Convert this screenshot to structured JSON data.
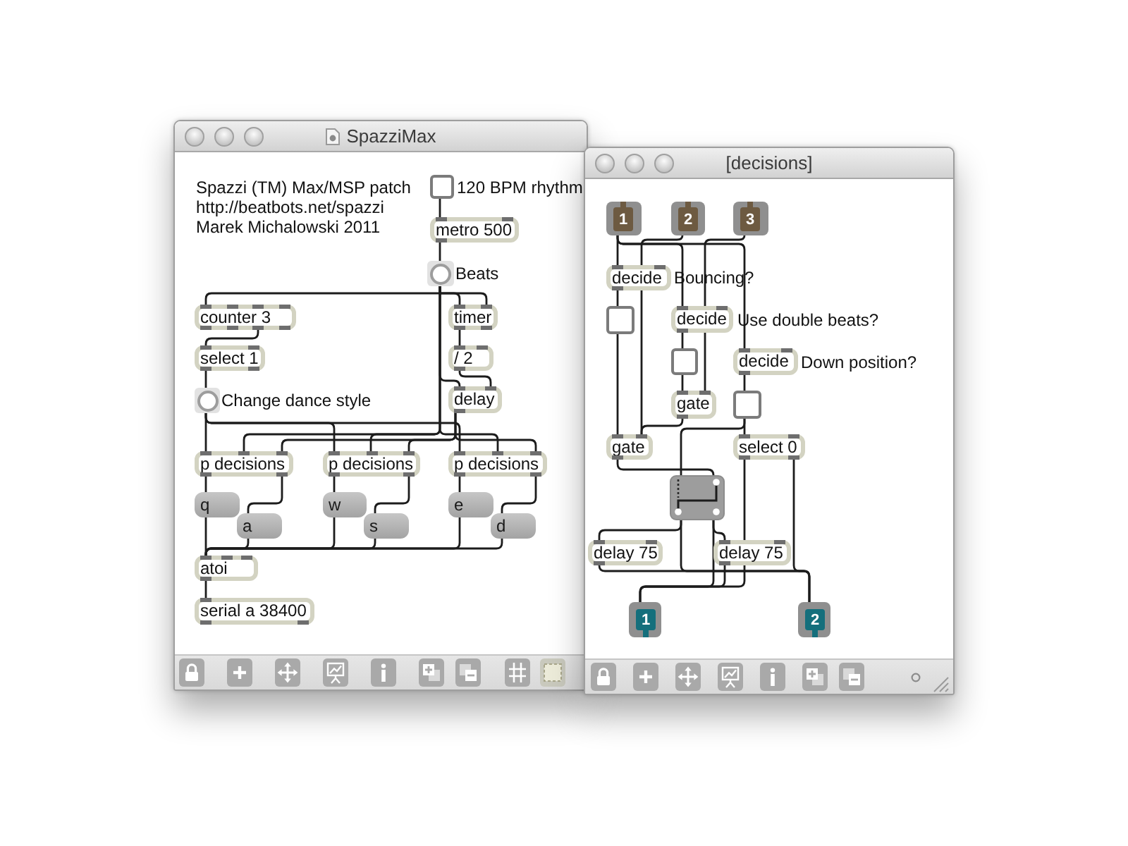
{
  "windows": [
    {
      "title": "SpazziMax",
      "boxes": [
        {
          "kind": "comment",
          "text": "Spazzi (TM) Max/MSP patch\nhttp://beatbots.net/spazzi\nMarek Michalowski 2011"
        },
        {
          "kind": "toggle",
          "checked": false
        },
        {
          "kind": "comment",
          "text": "120 BPM rhythm"
        },
        {
          "kind": "object",
          "text": "metro 500"
        },
        {
          "kind": "bang"
        },
        {
          "kind": "comment",
          "text": "Beats"
        },
        {
          "kind": "object",
          "text": "counter 3"
        },
        {
          "kind": "object",
          "text": "timer"
        },
        {
          "kind": "object",
          "text": "select 1"
        },
        {
          "kind": "object",
          "text": "/ 2"
        },
        {
          "kind": "bang"
        },
        {
          "kind": "comment",
          "text": "Change dance style"
        },
        {
          "kind": "object",
          "text": "delay"
        },
        {
          "kind": "object",
          "text": "p decisions"
        },
        {
          "kind": "object",
          "text": "p decisions"
        },
        {
          "kind": "object",
          "text": "p decisions"
        },
        {
          "kind": "message",
          "text": "q"
        },
        {
          "kind": "message",
          "text": "w"
        },
        {
          "kind": "message",
          "text": "e"
        },
        {
          "kind": "message",
          "text": "a"
        },
        {
          "kind": "message",
          "text": "s"
        },
        {
          "kind": "message",
          "text": "d"
        },
        {
          "kind": "object",
          "text": "atoi"
        },
        {
          "kind": "object",
          "text": "serial a 38400"
        }
      ]
    },
    {
      "title": "[decisions]",
      "boxes": [
        {
          "kind": "inlet",
          "text": "1"
        },
        {
          "kind": "inlet",
          "text": "2"
        },
        {
          "kind": "inlet",
          "text": "3"
        },
        {
          "kind": "object",
          "text": "decide"
        },
        {
          "kind": "comment",
          "text": "Bouncing?"
        },
        {
          "kind": "toggle",
          "checked": false
        },
        {
          "kind": "object",
          "text": "decide"
        },
        {
          "kind": "comment",
          "text": "Use double beats?"
        },
        {
          "kind": "toggle",
          "checked": false
        },
        {
          "kind": "object",
          "text": "decide"
        },
        {
          "kind": "comment",
          "text": "Down position?"
        },
        {
          "kind": "object",
          "text": "gate"
        },
        {
          "kind": "toggle",
          "checked": false
        },
        {
          "kind": "object",
          "text": "gate"
        },
        {
          "kind": "object",
          "text": "select 0"
        },
        {
          "kind": "gate_switch",
          "on": true
        },
        {
          "kind": "object",
          "text": "delay 75"
        },
        {
          "kind": "object",
          "text": "delay 75"
        },
        {
          "kind": "outlet",
          "text": "1"
        },
        {
          "kind": "outlet",
          "text": "2"
        }
      ]
    }
  ]
}
